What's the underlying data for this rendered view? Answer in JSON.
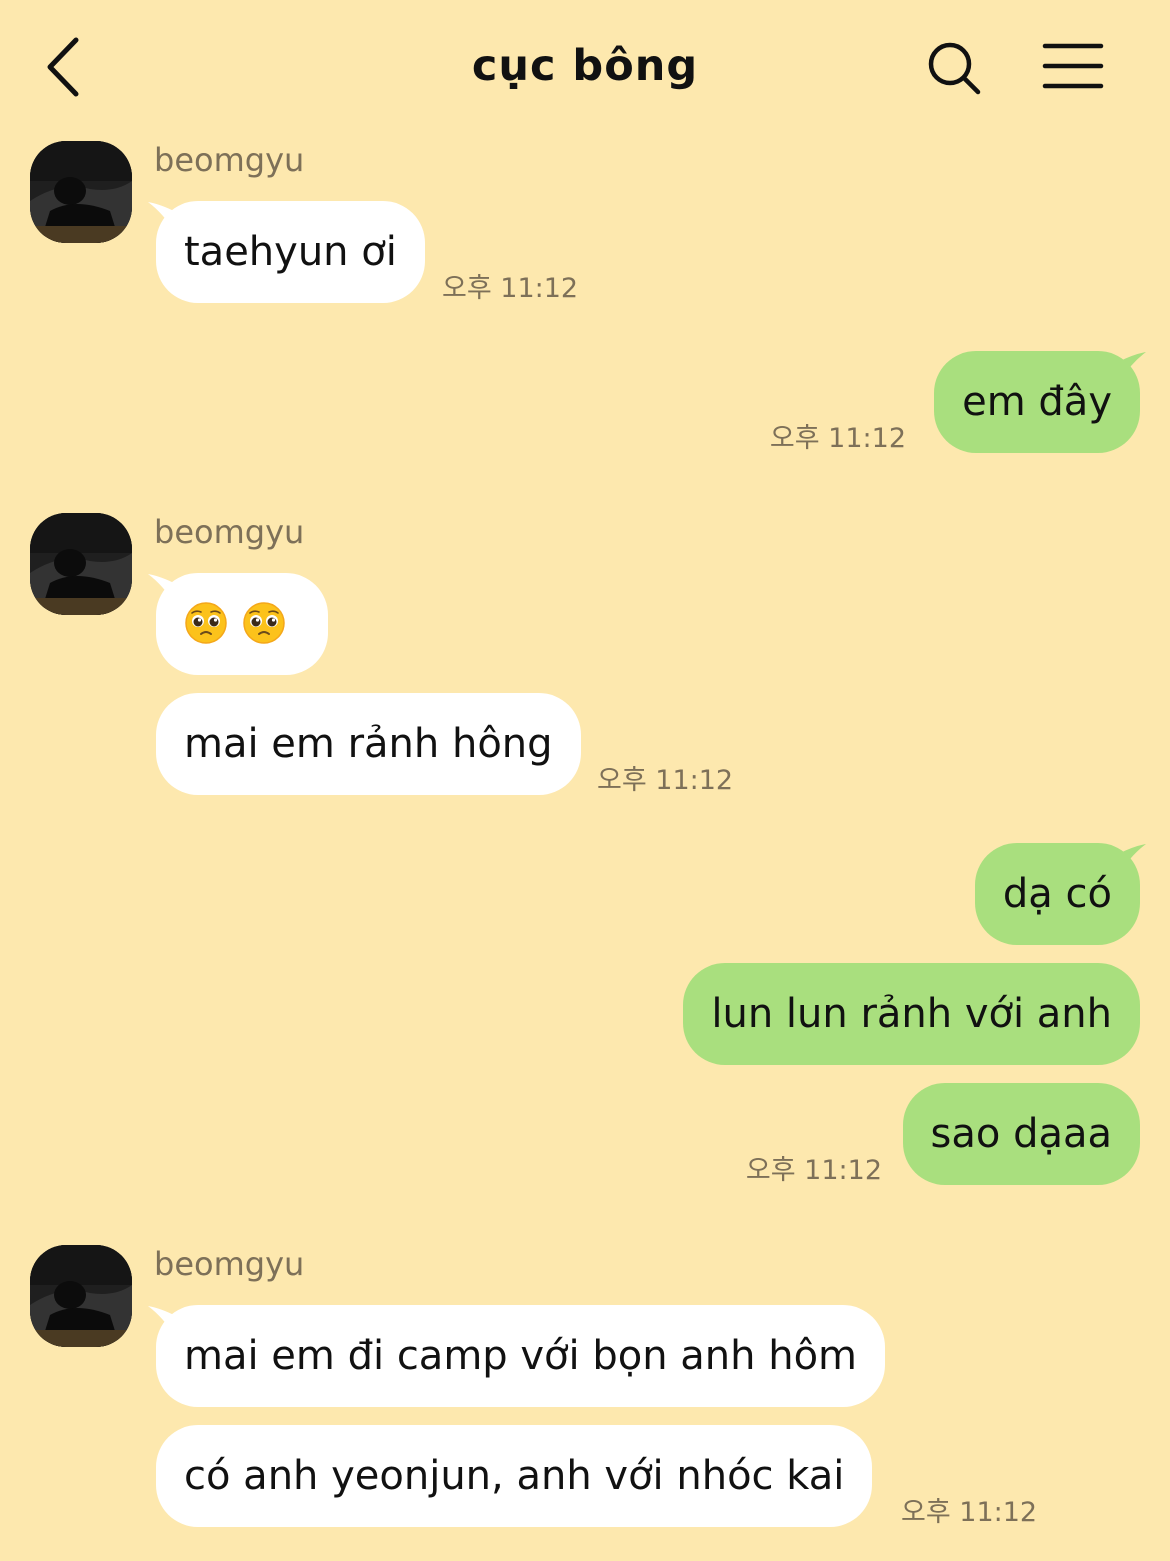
{
  "header": {
    "title": "cục bông",
    "back_icon": "chevron-left-icon",
    "search_icon": "search-icon",
    "menu_icon": "hamburger-menu-icon"
  },
  "colors": {
    "background": "#fde8ae",
    "incoming_bubble": "#ffffff",
    "outgoing_bubble": "#a9df7e",
    "meta_text": "#7d7058"
  },
  "conversation": {
    "group1": {
      "sender": "beomgyu",
      "messages": [
        "taehyun ơi"
      ],
      "time": "오후 11:12"
    },
    "group2": {
      "messages": [
        "em đây"
      ],
      "time": "오후 11:12"
    },
    "group3": {
      "sender": "beomgyu",
      "emoji_message": [
        "pleading-face-emoji",
        "pleading-face-emoji"
      ],
      "messages": [
        "mai em rảnh hông"
      ],
      "time": "오후 11:12"
    },
    "group4": {
      "messages": [
        "dạ có",
        "lun lun rảnh với anh",
        "sao dạaa"
      ],
      "time": "오후 11:12"
    },
    "group5": {
      "sender": "beomgyu",
      "messages": [
        "mai em đi camp với bọn anh hôm",
        "có anh yeonjun, anh với nhóc kai"
      ],
      "time": "오후 11:12"
    }
  }
}
